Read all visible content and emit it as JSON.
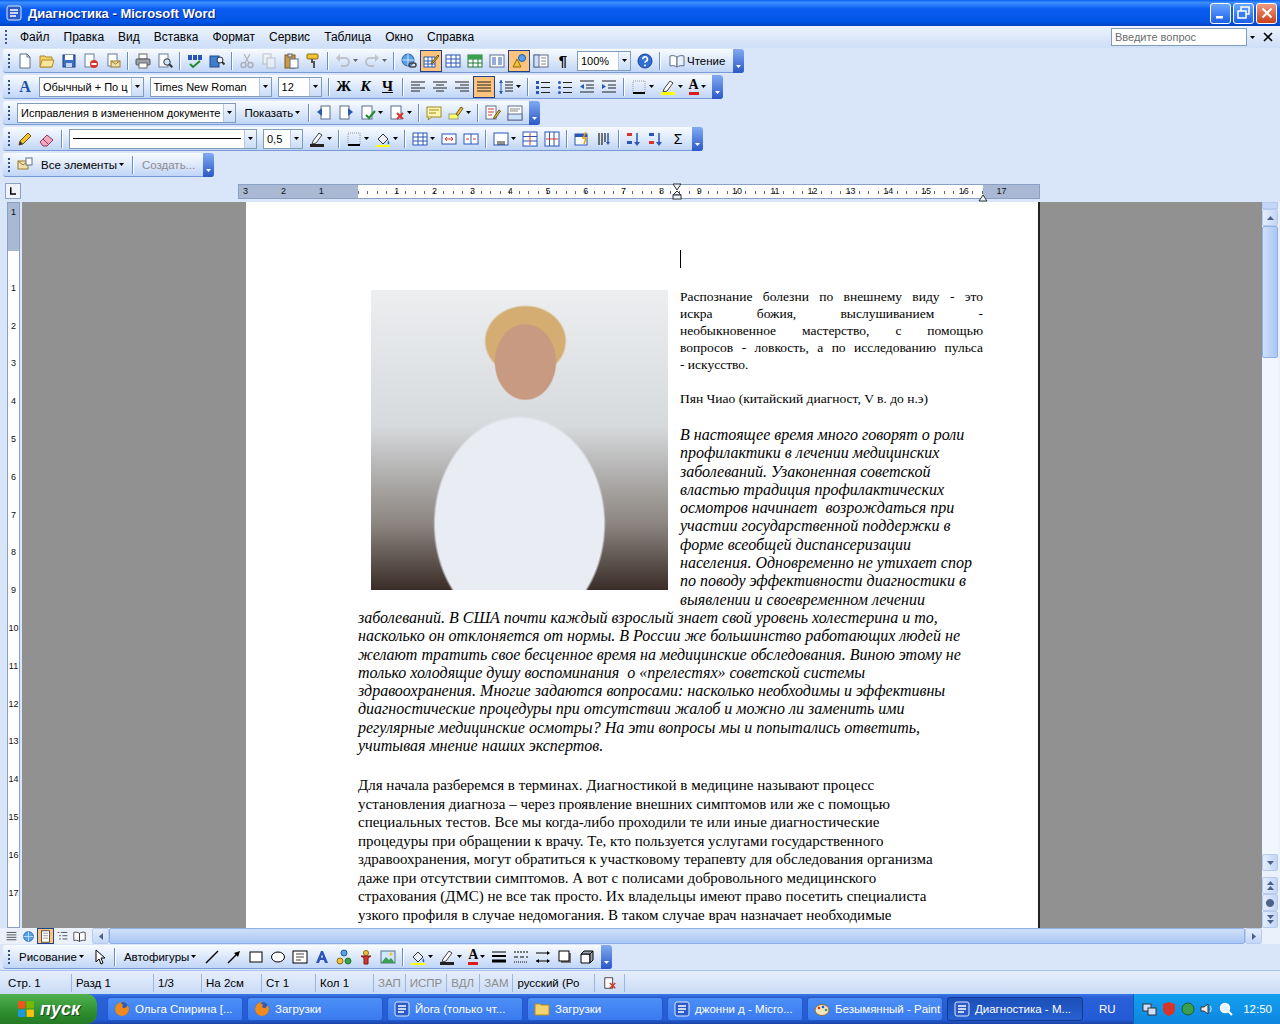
{
  "window": {
    "title": "Диагностика - Microsoft Word"
  },
  "menu": {
    "items": [
      "Файл",
      "Правка",
      "Вид",
      "Вставка",
      "Формат",
      "Сервис",
      "Таблица",
      "Окно",
      "Справка"
    ],
    "help_placeholder": "Введите вопрос"
  },
  "toolbars": [
    {
      "items": [
        {
          "kind": "button",
          "pressed": false,
          "disabled": false
        },
        {
          "kind": "button",
          "pressed": false,
          "disabled": false
        },
        {
          "kind": "button",
          "pressed": false,
          "disabled": false
        },
        {
          "kind": "button",
          "pressed": false,
          "disabled": false
        },
        {
          "kind": "button",
          "pressed": false,
          "disabled": false
        },
        {
          "kind": "sep"
        },
        {
          "kind": "button",
          "pressed": false,
          "disabled": false
        },
        {
          "kind": "button",
          "pressed": false,
          "disabled": false
        },
        {
          "kind": "sep"
        },
        {
          "kind": "button",
          "pressed": false,
          "disabled": false
        },
        {
          "kind": "button",
          "pressed": false,
          "disabled": false
        },
        {
          "kind": "sep"
        },
        {
          "kind": "button",
          "pressed": false,
          "disabled": true
        },
        {
          "kind": "button",
          "pressed": false,
          "disabled": true
        },
        {
          "kind": "button",
          "pressed": false,
          "disabled": false
        },
        {
          "kind": "button",
          "pressed": false,
          "disabled": false
        },
        {
          "kind": "sep"
        },
        {
          "kind": "dropbutton",
          "pressed": false,
          "disabled": true
        },
        {
          "kind": "dropbutton",
          "pressed": false,
          "disabled": true
        },
        {
          "kind": "sep"
        },
        {
          "kind": "button",
          "pressed": false,
          "disabled": false
        },
        {
          "kind": "button",
          "pressed": true,
          "disabled": false
        },
        {
          "kind": "button",
          "pressed": false,
          "disabled": false
        },
        {
          "kind": "button",
          "pressed": false,
          "disabled": false
        },
        {
          "kind": "button",
          "pressed": false,
          "disabled": false
        },
        {
          "kind": "button",
          "pressed": true,
          "disabled": false
        },
        {
          "kind": "button",
          "pressed": false,
          "disabled": false
        },
        {
          "kind": "glyph",
          "label": "¶",
          "pressed": false
        },
        {
          "kind": "combo",
          "value": "100%"
        },
        {
          "kind": "button",
          "pressed": false,
          "disabled": false
        },
        {
          "kind": "sep"
        },
        {
          "kind": "textbutton",
          "label": "Чтение",
          "disabled": false
        }
      ]
    },
    {
      "items": [
        {
          "kind": "glyph",
          "label": "A",
          "pressed": false
        },
        {
          "kind": "combo",
          "value": "Обычный + По ц"
        },
        {
          "kind": "combo",
          "value": "Times New Roman"
        },
        {
          "kind": "combo",
          "value": "12"
        },
        {
          "kind": "sep"
        },
        {
          "kind": "glyph",
          "label": "Ж",
          "pressed": false
        },
        {
          "kind": "glyph",
          "label": "К",
          "pressed": false
        },
        {
          "kind": "glyph",
          "label": "Ч",
          "pressed": false
        },
        {
          "kind": "sep"
        },
        {
          "kind": "button",
          "pressed": false,
          "disabled": false
        },
        {
          "kind": "button",
          "pressed": false,
          "disabled": false
        },
        {
          "kind": "button",
          "pressed": false,
          "disabled": false
        },
        {
          "kind": "button",
          "pressed": true,
          "disabled": false
        },
        {
          "kind": "dropbutton",
          "pressed": false,
          "disabled": false
        },
        {
          "kind": "sep"
        },
        {
          "kind": "button",
          "pressed": false,
          "disabled": false
        },
        {
          "kind": "button",
          "pressed": false,
          "disabled": false
        },
        {
          "kind": "button",
          "pressed": false,
          "disabled": false
        },
        {
          "kind": "button",
          "pressed": false,
          "disabled": false
        },
        {
          "kind": "sep"
        },
        {
          "kind": "dropbutton",
          "pressed": false,
          "disabled": false
        },
        {
          "kind": "dropbutton",
          "pressed": false,
          "disabled": false
        },
        {
          "kind": "dropglyph",
          "label": "A",
          "pressed": false
        }
      ]
    },
    {
      "items": [
        {
          "kind": "combo",
          "value": "Исправления в измененном документе"
        },
        {
          "kind": "textmenu",
          "label": "Показать",
          "disabled": false
        },
        {
          "kind": "sep"
        },
        {
          "kind": "button",
          "pressed": false,
          "disabled": false
        },
        {
          "kind": "button",
          "pressed": false,
          "disabled": false
        },
        {
          "kind": "dropbutton",
          "pressed": false,
          "disabled": false
        },
        {
          "kind": "dropbutton",
          "pressed": false,
          "disabled": false
        },
        {
          "kind": "sep"
        },
        {
          "kind": "button",
          "pressed": false,
          "disabled": false
        },
        {
          "kind": "dropbutton",
          "pressed": false,
          "disabled": false
        },
        {
          "kind": "sep"
        },
        {
          "kind": "button",
          "pressed": false,
          "disabled": false
        },
        {
          "kind": "button",
          "pressed": false,
          "disabled": false
        }
      ]
    },
    {
      "items": [
        {
          "kind": "button",
          "pressed": false,
          "disabled": false
        },
        {
          "kind": "button",
          "pressed": false,
          "disabled": false
        },
        {
          "kind": "sep"
        },
        {
          "kind": "linecombo"
        },
        {
          "kind": "combo",
          "value": "0,5"
        },
        {
          "kind": "dropbutton",
          "pressed": false,
          "disabled": false
        },
        {
          "kind": "sep"
        },
        {
          "kind": "dropbutton",
          "pressed": false,
          "disabled": false
        },
        {
          "kind": "dropbutton",
          "pressed": false,
          "disabled": false
        },
        {
          "kind": "sep"
        },
        {
          "kind": "dropbutton",
          "pressed": false,
          "disabled": false
        },
        {
          "kind": "button",
          "pressed": false,
          "disabled": false
        },
        {
          "kind": "button",
          "pressed": false,
          "disabled": false
        },
        {
          "kind": "sep"
        },
        {
          "kind": "dropbutton",
          "pressed": false,
          "disabled": false
        },
        {
          "kind": "button",
          "pressed": false,
          "disabled": false
        },
        {
          "kind": "button",
          "pressed": false,
          "disabled": false
        },
        {
          "kind": "sep"
        },
        {
          "kind": "button",
          "pressed": false,
          "disabled": false
        },
        {
          "kind": "button",
          "pressed": false,
          "disabled": false
        },
        {
          "kind": "sep"
        },
        {
          "kind": "button",
          "pressed": false,
          "disabled": false
        },
        {
          "kind": "button",
          "pressed": false,
          "disabled": false
        },
        {
          "kind": "glyph",
          "label": "Σ",
          "pressed": false
        }
      ]
    },
    {
      "items": [
        {
          "kind": "button",
          "pressed": false,
          "disabled": false
        },
        {
          "kind": "textmenu",
          "label": "Все элементы",
          "disabled": false
        },
        {
          "kind": "sep"
        },
        {
          "kind": "textbutton",
          "label": "Создать...",
          "disabled": true
        }
      ]
    }
  ],
  "ruler": {
    "left": [
      "3",
      "2",
      "1"
    ],
    "body": [
      "1",
      "2",
      "3",
      "4",
      "5",
      "6",
      "7",
      "8",
      "9",
      "10",
      "11",
      "12",
      "13",
      "14",
      "15",
      "16"
    ],
    "right": [
      "17"
    ]
  },
  "vruler": {
    "top": [
      "1"
    ],
    "body": [
      "1",
      "2",
      "3",
      "4",
      "5",
      "6",
      "7",
      "8",
      "9",
      "10",
      "11",
      "12",
      "13",
      "14",
      "15",
      "16",
      "17"
    ]
  },
  "document": {
    "epigraph": {
      "lines": [
        "Распознание болезни по внешнему виду - это",
        "искра божия, выслушиванием -",
        "необыкновенное мастерство, с помощью",
        "вопросов - ловкость, а по исследованию пульса",
        "- искусство."
      ],
      "author": "Пян Чиао (китайский диагност, V в. до н.э)"
    },
    "lead": {
      "side_lines": [
        "В настоящее время много говорят о роли",
        "профилактики в лечении медицинских",
        "заболеваний. Узаконенная советской",
        "властью традиция профилактических",
        "осмотров начинает  возрождаться при",
        "участии государственной поддержки в",
        "форме всеобщей диспансеризации",
        "населения. Одновременно не утихает спор",
        "по поводу эффективности диагностики в",
        "выявлении и своевременном лечении"
      ],
      "full_lines": [
        "заболеваний. В США почти каждый взрослый знает свой уровень холестерина и то,",
        "насколько он отклоняется от нормы. В России же большинство работающих людей не",
        "желают тратить свое бесценное время на медицинские обследования. Виною этому не",
        "только холодящие душу воспоминания  о «прелестях» советской системы",
        "здравоохранения. Многие задаются вопросами: насколько необходимы и эффективны",
        "диагностические процедуры при отсутствии жалоб и можно ли заменить ими",
        "регулярные медицинские осмотры? На эти вопросы мы и попытались ответить,",
        "учитывая мнение наших экспертов."
      ]
    },
    "body": {
      "lines": [
        "Для начала разберемся в терминах. Диагностикой в медицине называют процесс",
        "установления диагноза – через проявление внешних симптомов или же с помощью",
        "специальных тестов. Все мы когда-либо проходили те или иные диагностические",
        "процедуры при обращении к врачу. Те, кто пользуется услугами государственного",
        "здравоохранения, могут обратиться к участковому терапевту для обследования организма",
        "даже при отсутствии симптомов. А вот с полисами добровольного медицинского",
        "страхования (ДМС) не все так просто. Их владельцы имеют право посетить специалиста",
        "узкого профиля в случае недомогания. В таком случае врач назначает необходимые"
      ]
    }
  },
  "vertical_scroll": {
    "level": 0.21
  },
  "horizontal_scroll": {
    "level": 1
  },
  "view_buttons": [
    {
      "selected": false
    },
    {
      "selected": false
    },
    {
      "selected": true
    },
    {
      "selected": false
    },
    {
      "selected": false
    }
  ],
  "drawing_toolbar": {
    "items": [
      {
        "kind": "textmenu",
        "label": "Рисование",
        "disabled": false
      },
      {
        "kind": "button",
        "pressed": false,
        "disabled": false
      },
      {
        "kind": "sep"
      },
      {
        "kind": "textmenu",
        "label": "Автофигуры",
        "disabled": false
      },
      {
        "kind": "button",
        "pressed": false,
        "disabled": false
      },
      {
        "kind": "button",
        "pressed": false,
        "disabled": false
      },
      {
        "kind": "button",
        "pressed": false,
        "disabled": false
      },
      {
        "kind": "button",
        "pressed": false,
        "disabled": false
      },
      {
        "kind": "button",
        "pressed": false,
        "disabled": false
      },
      {
        "kind": "button",
        "pressed": false,
        "disabled": false
      },
      {
        "kind": "button",
        "pressed": false,
        "disabled": false
      },
      {
        "kind": "button",
        "pressed": false,
        "disabled": false
      },
      {
        "kind": "button",
        "pressed": false,
        "disabled": false
      },
      {
        "kind": "sep"
      },
      {
        "kind": "dropbutton",
        "pressed": false,
        "disabled": false
      },
      {
        "kind": "dropbutton",
        "pressed": false,
        "disabled": false
      },
      {
        "kind": "dropglyph",
        "label": "A",
        "pressed": false
      },
      {
        "kind": "button",
        "pressed": false,
        "disabled": false
      },
      {
        "kind": "button",
        "pressed": false,
        "disabled": false
      },
      {
        "kind": "button",
        "pressed": false,
        "disabled": false
      },
      {
        "kind": "button",
        "pressed": false,
        "disabled": false
      },
      {
        "kind": "button",
        "pressed": false,
        "disabled": false
      }
    ]
  },
  "status_bar": {
    "items": [
      {
        "text": "Стр. 1",
        "disabled": false
      },
      {
        "text": "Разд 1",
        "disabled": false
      },
      {
        "text": "1/3",
        "disabled": false
      },
      {
        "text": "На 2см",
        "disabled": false
      },
      {
        "text": "Ст 1",
        "disabled": false
      },
      {
        "text": "Кол 1",
        "disabled": false
      },
      {
        "text": "ЗАП",
        "disabled": true
      },
      {
        "text": "ИСПР",
        "disabled": true
      },
      {
        "text": "ВДЛ",
        "disabled": true
      },
      {
        "text": "ЗАМ",
        "disabled": true
      },
      {
        "text": "русский (Ро",
        "disabled": false
      }
    ]
  },
  "taskbar": {
    "start": "пуск",
    "tasks": [
      {
        "label": "Ольга Спирина [...",
        "selected": false
      },
      {
        "label": "Загрузки",
        "selected": false
      },
      {
        "label": "Йога (только чт...",
        "selected": false
      },
      {
        "label": "Загрузки",
        "selected": false
      },
      {
        "label": "джонни д - Micro...",
        "selected": false
      },
      {
        "label": "Безымянный - Paint",
        "selected": false
      },
      {
        "label": "Диагностика - M...",
        "selected": true
      }
    ],
    "lang": "RU",
    "clock": "12:50"
  }
}
